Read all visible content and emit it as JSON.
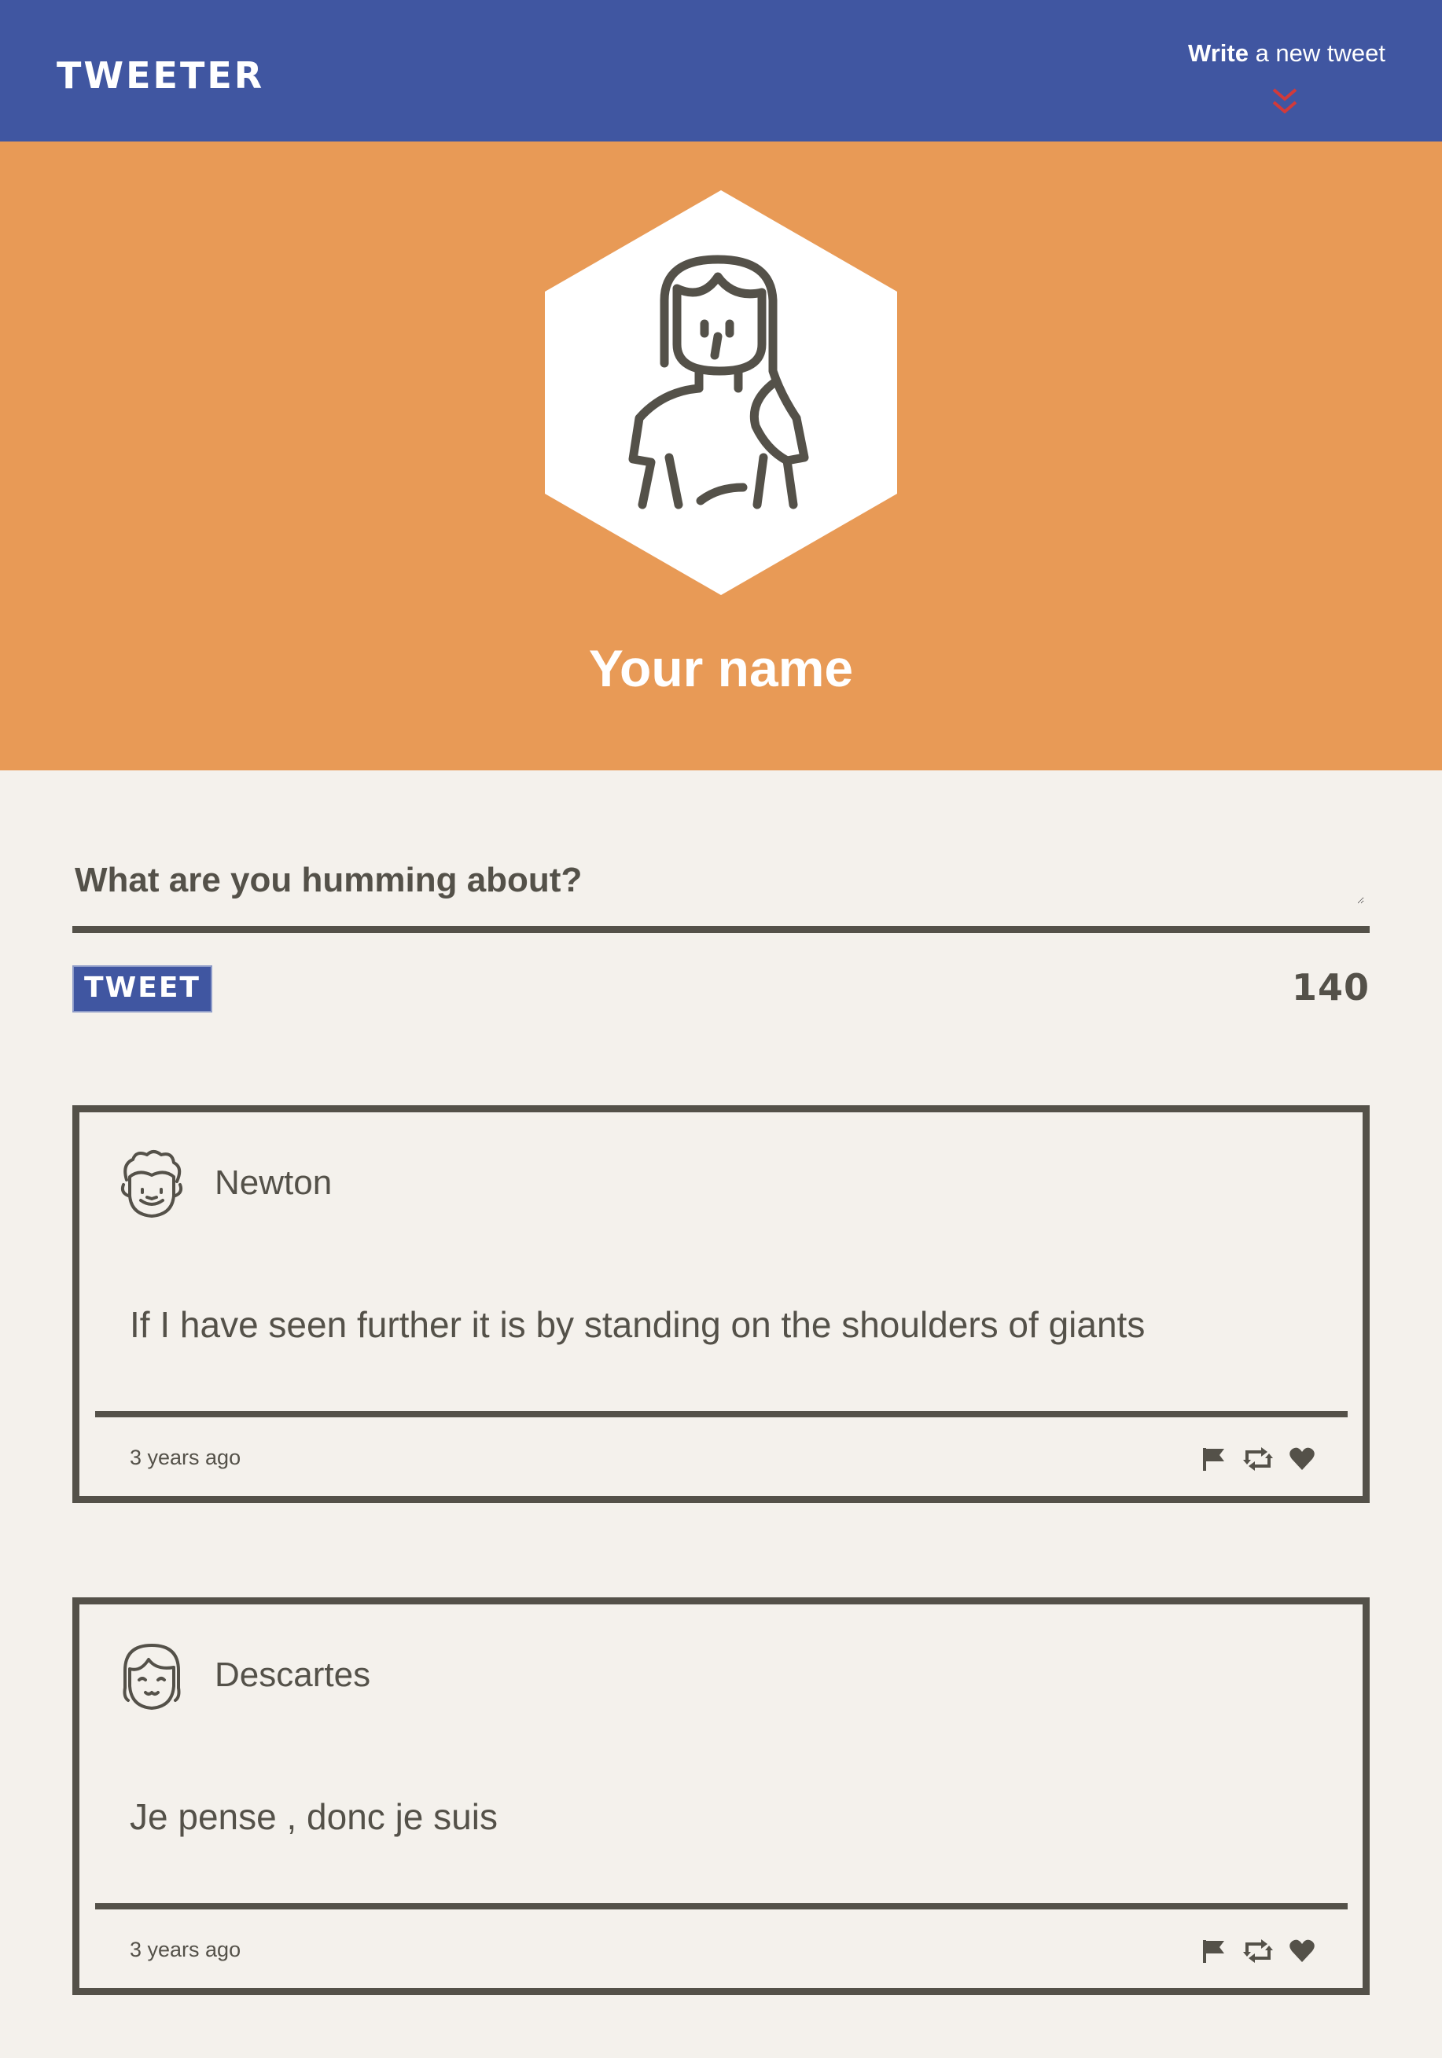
{
  "nav": {
    "logo": "TWEETER",
    "write_bold": "Write",
    "write_rest": " a new tweet",
    "chevron_icon": "double-chevron-down-icon",
    "chevron_color": "#d23a3a",
    "bg_color": "#4056a1"
  },
  "profile": {
    "name": "Your name",
    "avatar_icon": "woman-avatar-icon",
    "bg_color": "#e89a56"
  },
  "composer": {
    "placeholder": "What are you humming about?",
    "button_label": "TWEET",
    "counter": "140"
  },
  "tweets": [
    {
      "author": "Newton",
      "avatar_icon": "curly-hair-man-avatar-icon",
      "content": "If I have seen further it is by standing on the shoulders of giants",
      "time": "3 years ago",
      "actions": [
        "flag-icon",
        "retweet-icon",
        "heart-icon"
      ]
    },
    {
      "author": "Descartes",
      "avatar_icon": "bangs-hair-avatar-icon",
      "content": "Je pense , donc je suis",
      "time": "3 years ago",
      "actions": [
        "flag-icon",
        "retweet-icon",
        "heart-icon"
      ]
    }
  ]
}
